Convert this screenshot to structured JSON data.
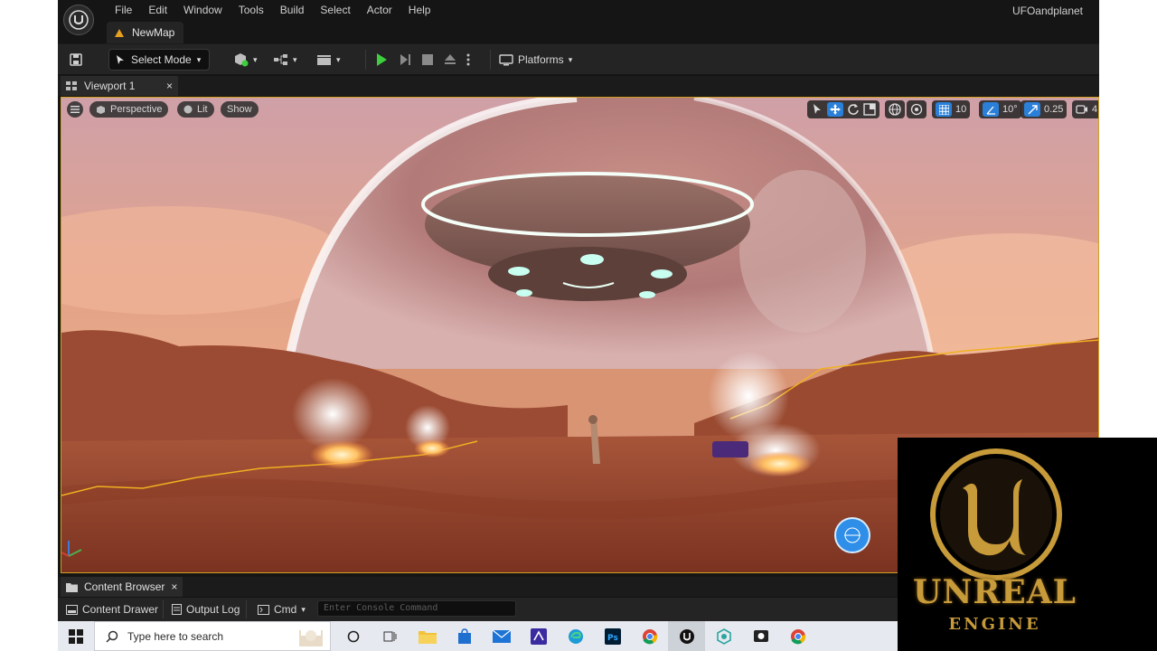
{
  "menu": [
    "File",
    "Edit",
    "Window",
    "Tools",
    "Build",
    "Select",
    "Actor",
    "Help"
  ],
  "project_name": "UFOandplanet",
  "map_tab": "NewMap",
  "toolbar": {
    "select_mode": "Select Mode",
    "platforms": "Platforms"
  },
  "viewport": {
    "tab_label": "Viewport 1",
    "perspective": "Perspective",
    "lit": "Lit",
    "show": "Show",
    "grid_snap": "10",
    "rotation_snap": "10°",
    "scale_snap": "0.25",
    "camera_speed": "4"
  },
  "bottom": {
    "content_browser_tab": "Content Browser",
    "content_drawer": "Content Drawer",
    "output_log": "Output Log",
    "cmd": "Cmd",
    "console_placeholder": "Enter Console Command"
  },
  "taskbar": {
    "search_placeholder": "Type here to search"
  },
  "logo": {
    "title": "UNREAL",
    "subtitle": "ENGINE"
  },
  "colors": {
    "play_green": "#3ecf3e",
    "accent_blue": "#2a7fd8",
    "selection_gold": "#d0a020",
    "logo_gold": "#c79a3a"
  }
}
